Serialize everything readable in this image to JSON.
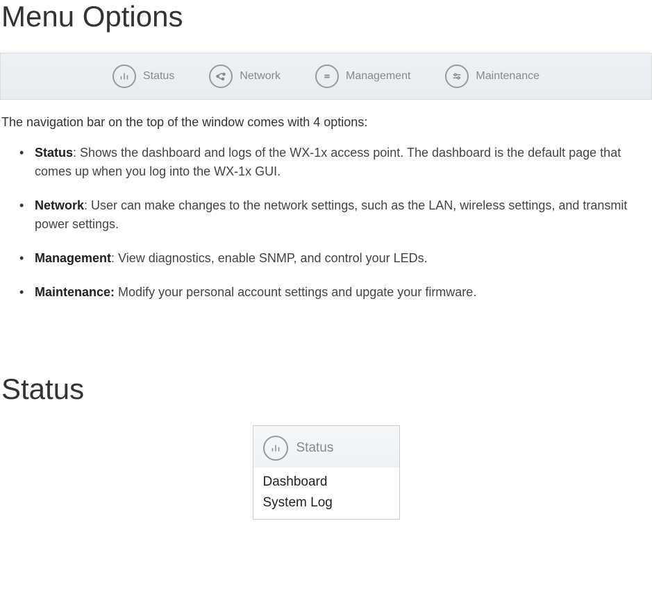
{
  "headings": {
    "menu_options": "Menu Options",
    "status": "Status"
  },
  "navbar": {
    "items": [
      {
        "label": "Status"
      },
      {
        "label": "Network"
      },
      {
        "label": "Management"
      },
      {
        "label": "Maintenance"
      }
    ]
  },
  "intro": "The navigation bar on the top of the window comes with 4 options:",
  "bullets": [
    {
      "label": "Status",
      "suffix": ": ",
      "text": "Shows the dashboard and logs of the WX-1x access point. The dashboard is the default page that comes up when you log into the WX-1x GUI."
    },
    {
      "label": "Network",
      "suffix": ": ",
      "text": "User can make changes to the network settings, such as the LAN, wireless settings, and transmit power settings."
    },
    {
      "label": "Management",
      "suffix": ": ",
      "text": "View diagnostics, enable SNMP, and control your LEDs."
    },
    {
      "label": "Maintenance:",
      "suffix": " ",
      "text": "Modify your personal account settings and upgate your firmware."
    }
  ],
  "status_menu": {
    "header": "Status",
    "items": [
      "Dashboard",
      "System Log"
    ]
  }
}
